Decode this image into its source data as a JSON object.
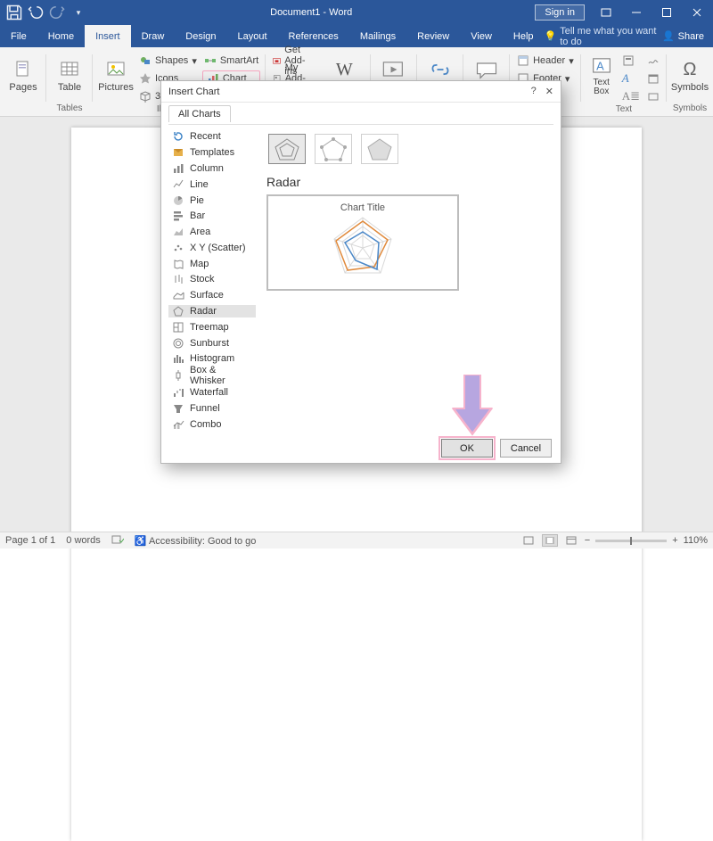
{
  "titlebar": {
    "doc_title": "Document1 - Word",
    "signin": "Sign in"
  },
  "menu": {
    "tabs": [
      "File",
      "Home",
      "Insert",
      "Draw",
      "Design",
      "Layout",
      "References",
      "Mailings",
      "Review",
      "View",
      "Help"
    ],
    "active_index": 2,
    "tell_me": "Tell me what you want to do",
    "share": "Share"
  },
  "ribbon": {
    "pages": "Pages",
    "tables_lbl": "Tables",
    "table": "Table",
    "illus_lbl": "Illustrations",
    "pictures": "Pictures",
    "shapes": "Shapes",
    "icons_item": "Icons",
    "models": "3D Mode",
    "smartart": "SmartArt",
    "chart": "Chart",
    "getaddins": "Get Add-ins",
    "myaddins": "My Add-ins",
    "wikipedia": "Wikipedia",
    "online": "Online",
    "links": "Links",
    "comment": "Comment",
    "header": "Header",
    "footer": "Footer",
    "textbox": "Text Box",
    "text_lbl": "Text",
    "symbols_lbl": "Symbols",
    "symbols": "Symbols"
  },
  "dialog": {
    "title": "Insert Chart",
    "tab": "All Charts",
    "help": "?",
    "close": "✕",
    "types": [
      {
        "icon": "recent",
        "label": "Recent"
      },
      {
        "icon": "templates",
        "label": "Templates"
      },
      {
        "icon": "column",
        "label": "Column"
      },
      {
        "icon": "line",
        "label": "Line"
      },
      {
        "icon": "pie",
        "label": "Pie"
      },
      {
        "icon": "bar",
        "label": "Bar"
      },
      {
        "icon": "area",
        "label": "Area"
      },
      {
        "icon": "scatter",
        "label": "X Y (Scatter)"
      },
      {
        "icon": "map",
        "label": "Map"
      },
      {
        "icon": "stock",
        "label": "Stock"
      },
      {
        "icon": "surface",
        "label": "Surface"
      },
      {
        "icon": "radar",
        "label": "Radar"
      },
      {
        "icon": "treemap",
        "label": "Treemap"
      },
      {
        "icon": "sunburst",
        "label": "Sunburst"
      },
      {
        "icon": "histogram",
        "label": "Histogram"
      },
      {
        "icon": "boxwhisker",
        "label": "Box & Whisker"
      },
      {
        "icon": "waterfall",
        "label": "Waterfall"
      },
      {
        "icon": "funnel",
        "label": "Funnel"
      },
      {
        "icon": "combo",
        "label": "Combo"
      }
    ],
    "selected_index": 11,
    "section_title": "Radar",
    "preview_title": "Chart Title",
    "ok": "OK",
    "cancel": "Cancel"
  },
  "status": {
    "page": "Page 1 of 1",
    "words": "0 words",
    "acc": "Accessibility: Good to go",
    "zoom": "110%"
  }
}
